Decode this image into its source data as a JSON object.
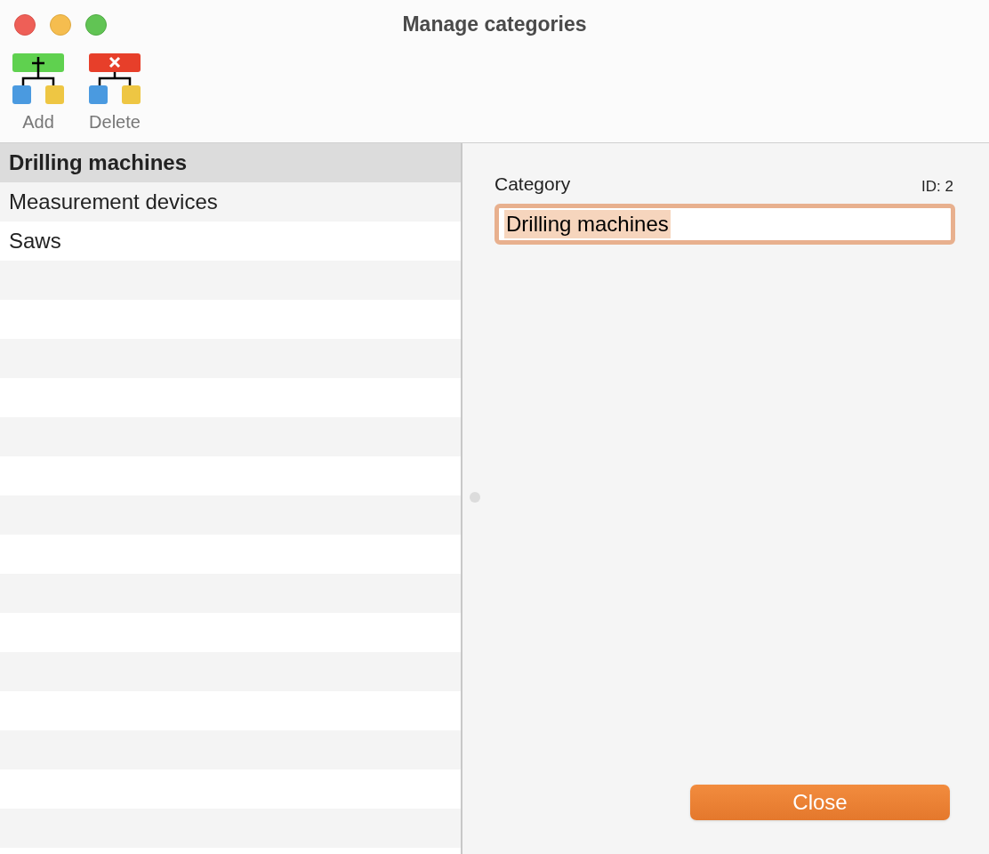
{
  "window": {
    "title": "Manage categories"
  },
  "toolbar": [
    {
      "kind": "add",
      "label": "Add"
    },
    {
      "kind": "delete",
      "label": "Delete"
    }
  ],
  "categories": [
    {
      "name": "Drilling machines",
      "selected": true
    },
    {
      "name": "Measurement devices",
      "selected": false
    },
    {
      "name": "Saws",
      "selected": false
    }
  ],
  "detail": {
    "label": "Category",
    "id": "ID: 2",
    "value": "Drilling machines"
  },
  "buttons": {
    "close": "Close"
  }
}
